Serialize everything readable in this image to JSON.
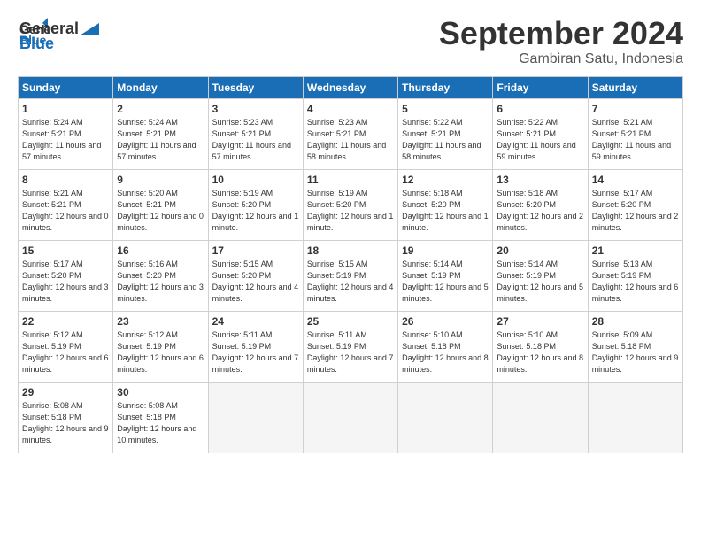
{
  "header": {
    "logo_general": "General",
    "logo_blue": "Blue",
    "month": "September 2024",
    "location": "Gambiran Satu, Indonesia"
  },
  "weekdays": [
    "Sunday",
    "Monday",
    "Tuesday",
    "Wednesday",
    "Thursday",
    "Friday",
    "Saturday"
  ],
  "weeks": [
    [
      {
        "day": "1",
        "info": "Sunrise: 5:24 AM\nSunset: 5:21 PM\nDaylight: 11 hours\nand 57 minutes."
      },
      {
        "day": "2",
        "info": "Sunrise: 5:24 AM\nSunset: 5:21 PM\nDaylight: 11 hours\nand 57 minutes."
      },
      {
        "day": "3",
        "info": "Sunrise: 5:23 AM\nSunset: 5:21 PM\nDaylight: 11 hours\nand 57 minutes."
      },
      {
        "day": "4",
        "info": "Sunrise: 5:23 AM\nSunset: 5:21 PM\nDaylight: 11 hours\nand 58 minutes."
      },
      {
        "day": "5",
        "info": "Sunrise: 5:22 AM\nSunset: 5:21 PM\nDaylight: 11 hours\nand 58 minutes."
      },
      {
        "day": "6",
        "info": "Sunrise: 5:22 AM\nSunset: 5:21 PM\nDaylight: 11 hours\nand 59 minutes."
      },
      {
        "day": "7",
        "info": "Sunrise: 5:21 AM\nSunset: 5:21 PM\nDaylight: 11 hours\nand 59 minutes."
      }
    ],
    [
      {
        "day": "8",
        "info": "Sunrise: 5:21 AM\nSunset: 5:21 PM\nDaylight: 12 hours\nand 0 minutes."
      },
      {
        "day": "9",
        "info": "Sunrise: 5:20 AM\nSunset: 5:21 PM\nDaylight: 12 hours\nand 0 minutes."
      },
      {
        "day": "10",
        "info": "Sunrise: 5:19 AM\nSunset: 5:20 PM\nDaylight: 12 hours\nand 1 minute."
      },
      {
        "day": "11",
        "info": "Sunrise: 5:19 AM\nSunset: 5:20 PM\nDaylight: 12 hours\nand 1 minute."
      },
      {
        "day": "12",
        "info": "Sunrise: 5:18 AM\nSunset: 5:20 PM\nDaylight: 12 hours\nand 1 minute."
      },
      {
        "day": "13",
        "info": "Sunrise: 5:18 AM\nSunset: 5:20 PM\nDaylight: 12 hours\nand 2 minutes."
      },
      {
        "day": "14",
        "info": "Sunrise: 5:17 AM\nSunset: 5:20 PM\nDaylight: 12 hours\nand 2 minutes."
      }
    ],
    [
      {
        "day": "15",
        "info": "Sunrise: 5:17 AM\nSunset: 5:20 PM\nDaylight: 12 hours\nand 3 minutes."
      },
      {
        "day": "16",
        "info": "Sunrise: 5:16 AM\nSunset: 5:20 PM\nDaylight: 12 hours\nand 3 minutes."
      },
      {
        "day": "17",
        "info": "Sunrise: 5:15 AM\nSunset: 5:20 PM\nDaylight: 12 hours\nand 4 minutes."
      },
      {
        "day": "18",
        "info": "Sunrise: 5:15 AM\nSunset: 5:19 PM\nDaylight: 12 hours\nand 4 minutes."
      },
      {
        "day": "19",
        "info": "Sunrise: 5:14 AM\nSunset: 5:19 PM\nDaylight: 12 hours\nand 5 minutes."
      },
      {
        "day": "20",
        "info": "Sunrise: 5:14 AM\nSunset: 5:19 PM\nDaylight: 12 hours\nand 5 minutes."
      },
      {
        "day": "21",
        "info": "Sunrise: 5:13 AM\nSunset: 5:19 PM\nDaylight: 12 hours\nand 6 minutes."
      }
    ],
    [
      {
        "day": "22",
        "info": "Sunrise: 5:12 AM\nSunset: 5:19 PM\nDaylight: 12 hours\nand 6 minutes."
      },
      {
        "day": "23",
        "info": "Sunrise: 5:12 AM\nSunset: 5:19 PM\nDaylight: 12 hours\nand 6 minutes."
      },
      {
        "day": "24",
        "info": "Sunrise: 5:11 AM\nSunset: 5:19 PM\nDaylight: 12 hours\nand 7 minutes."
      },
      {
        "day": "25",
        "info": "Sunrise: 5:11 AM\nSunset: 5:19 PM\nDaylight: 12 hours\nand 7 minutes."
      },
      {
        "day": "26",
        "info": "Sunrise: 5:10 AM\nSunset: 5:18 PM\nDaylight: 12 hours\nand 8 minutes."
      },
      {
        "day": "27",
        "info": "Sunrise: 5:10 AM\nSunset: 5:18 PM\nDaylight: 12 hours\nand 8 minutes."
      },
      {
        "day": "28",
        "info": "Sunrise: 5:09 AM\nSunset: 5:18 PM\nDaylight: 12 hours\nand 9 minutes."
      }
    ],
    [
      {
        "day": "29",
        "info": "Sunrise: 5:08 AM\nSunset: 5:18 PM\nDaylight: 12 hours\nand 9 minutes."
      },
      {
        "day": "30",
        "info": "Sunrise: 5:08 AM\nSunset: 5:18 PM\nDaylight: 12 hours\nand 10 minutes."
      },
      {
        "day": "",
        "info": ""
      },
      {
        "day": "",
        "info": ""
      },
      {
        "day": "",
        "info": ""
      },
      {
        "day": "",
        "info": ""
      },
      {
        "day": "",
        "info": ""
      }
    ]
  ]
}
